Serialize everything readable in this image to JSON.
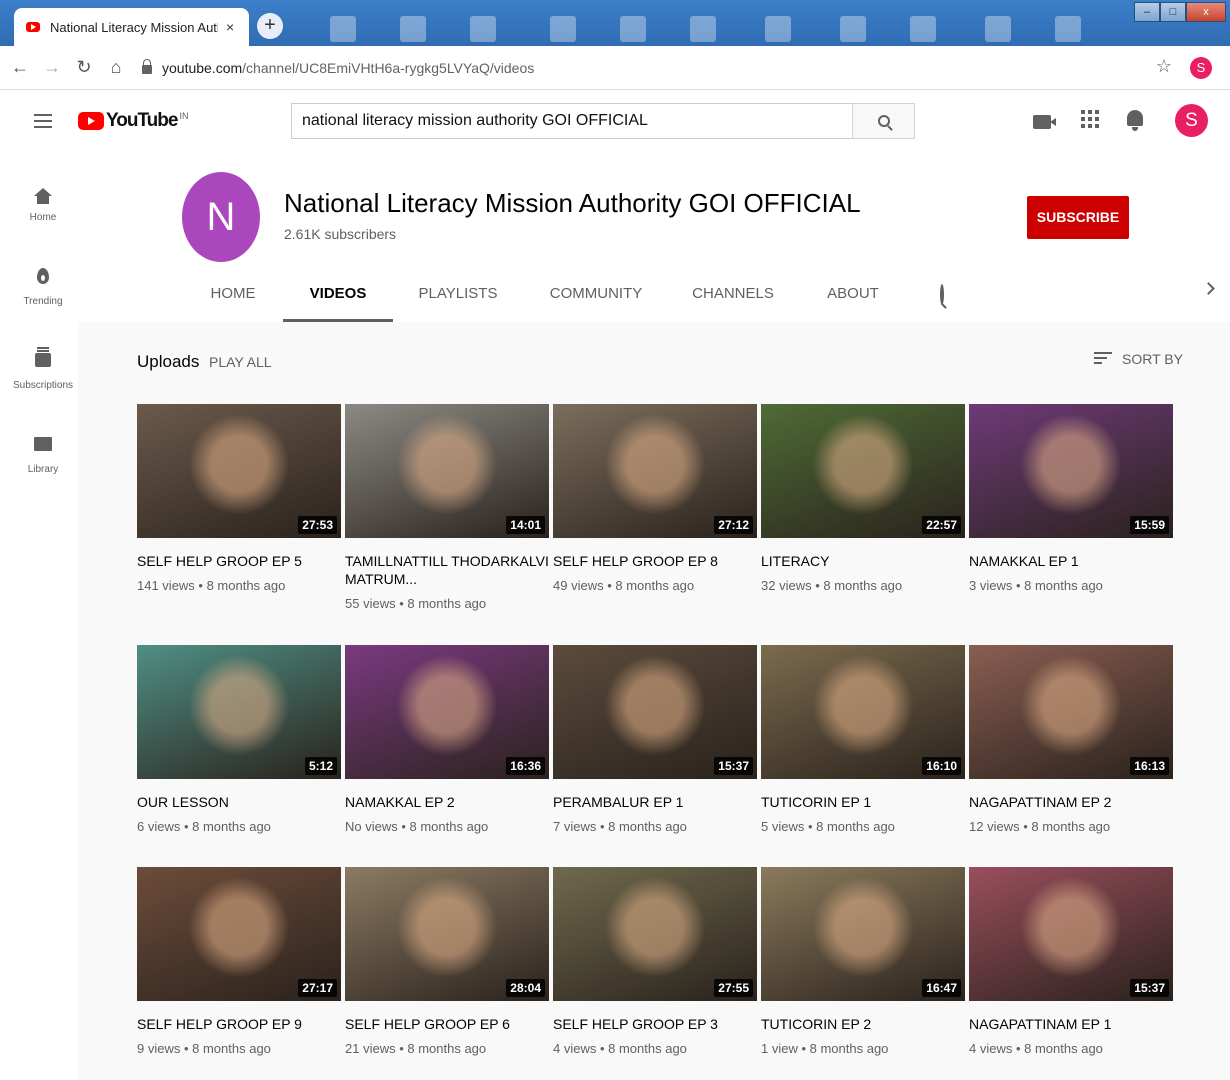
{
  "browser": {
    "tab_title": "National Literacy Mission Author",
    "tab_close": "×",
    "new_tab": "+",
    "url_host": "youtube.com",
    "url_path": "/channel/UC8EmiVHtH6a-rygkg5LVYaQ/videos",
    "profile_letter": "S"
  },
  "youtube": {
    "logo_text": "YouTube",
    "country": "IN",
    "search_value": "national literacy mission authority GOI OFFICIAL",
    "avatar_letter": "S"
  },
  "sidebar": {
    "items": [
      {
        "label": "Home",
        "icon": "home-icon"
      },
      {
        "label": "Trending",
        "icon": "trending-icon"
      },
      {
        "label": "Subscriptions",
        "icon": "subscriptions-icon"
      },
      {
        "label": "Library",
        "icon": "library-icon"
      }
    ]
  },
  "channel": {
    "avatar_letter": "N",
    "avatar_color": "#ab47bc",
    "name": "National Literacy Mission Authority GOI OFFICIAL",
    "subscribers": "2.61K subscribers",
    "subscribe_label": "SUBSCRIBE",
    "tabs": [
      "HOME",
      "VIDEOS",
      "PLAYLISTS",
      "COMMUNITY",
      "CHANNELS",
      "ABOUT"
    ],
    "active_tab": "VIDEOS"
  },
  "uploads": {
    "heading": "Uploads",
    "play_all": "PLAY ALL",
    "sort_by": "SORT BY"
  },
  "videos": [
    {
      "title": "SELF HELP GROOP EP 5",
      "meta": "141 views • 8 months ago",
      "duration": "27:53",
      "bg": "#6b5a4c"
    },
    {
      "title": "TAMILLNATTILL THODARKALVI MATRUM...",
      "meta": "55 views • 8 months ago",
      "duration": "14:01",
      "bg": "#8c8a84"
    },
    {
      "title": "SELF HELP GROOP EP 8",
      "meta": "49 views • 8 months ago",
      "duration": "27:12",
      "bg": "#7c6e5c"
    },
    {
      "title": "LITERACY",
      "meta": "32 views • 8 months ago",
      "duration": "22:57",
      "bg": "#4f6b36"
    },
    {
      "title": "NAMAKKAL EP 1",
      "meta": "3 views • 8 months ago",
      "duration": "15:59",
      "bg": "#6e3a78"
    },
    {
      "title": "OUR LESSON",
      "meta": "6 views • 8 months ago",
      "duration": "5:12",
      "bg": "#4f8f84"
    },
    {
      "title": "NAMAKKAL EP 2",
      "meta": "No views • 8 months ago",
      "duration": "16:36",
      "bg": "#7a3a80"
    },
    {
      "title": "PERAMBALUR EP 1",
      "meta": "7 views • 8 months ago",
      "duration": "15:37",
      "bg": "#5b4b3c"
    },
    {
      "title": "TUTICORIN EP 1",
      "meta": "5 views • 8 months ago",
      "duration": "16:10",
      "bg": "#7b6b4e"
    },
    {
      "title": "NAGAPATTINAM EP 2",
      "meta": "12 views • 8 months ago",
      "duration": "16:13",
      "bg": "#8a5e52"
    },
    {
      "title": "SELF HELP GROOP EP 9",
      "meta": "9 views • 8 months ago",
      "duration": "27:17",
      "bg": "#6d4c3a"
    },
    {
      "title": "SELF HELP GROOP EP 6",
      "meta": "21 views • 8 months ago",
      "duration": "28:04",
      "bg": "#8c7b63"
    },
    {
      "title": "SELF HELP GROOP EP 3",
      "meta": "4 views • 8 months ago",
      "duration": "27:55",
      "bg": "#6f6a4d"
    },
    {
      "title": "TUTICORIN EP 2",
      "meta": "1 view • 8 months ago",
      "duration": "16:47",
      "bg": "#8b7a5c"
    },
    {
      "title": "NAGAPATTINAM EP 1",
      "meta": "4 views • 8 months ago",
      "duration": "15:37",
      "bg": "#9a4e5e"
    }
  ]
}
